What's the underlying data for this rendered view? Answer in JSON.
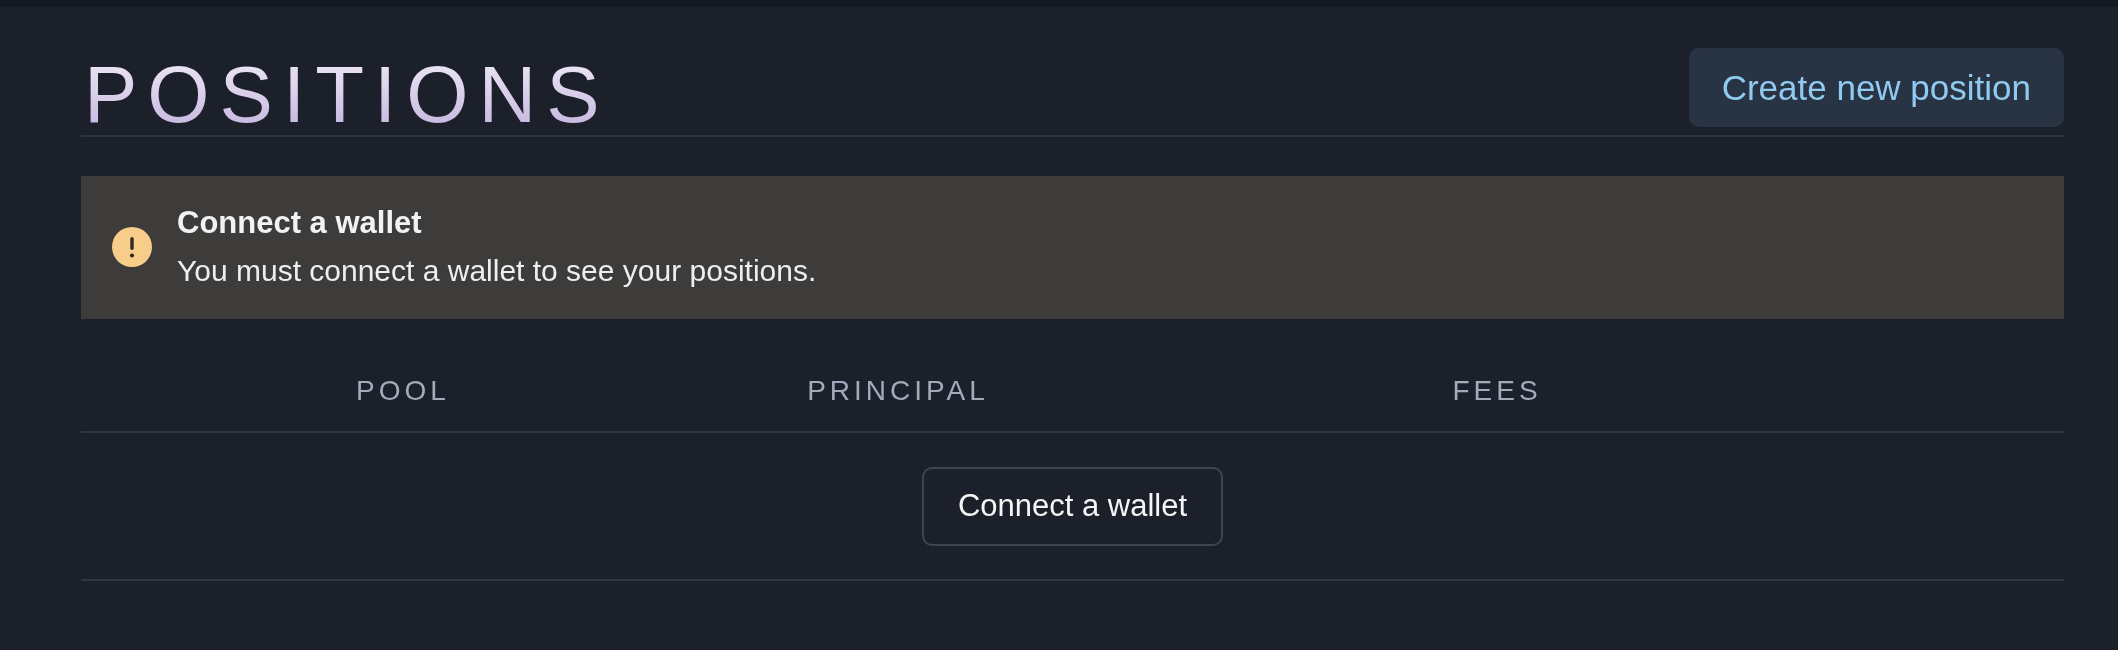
{
  "header": {
    "title": "POSITIONS",
    "create_button": "Create new position"
  },
  "alert": {
    "kind": "warning",
    "title": "Connect a wallet",
    "message": "You must connect a wallet to see your positions."
  },
  "table": {
    "columns": [
      "POOL",
      "PRINCIPAL",
      "FEES"
    ],
    "empty_action": "Connect a wallet"
  }
}
